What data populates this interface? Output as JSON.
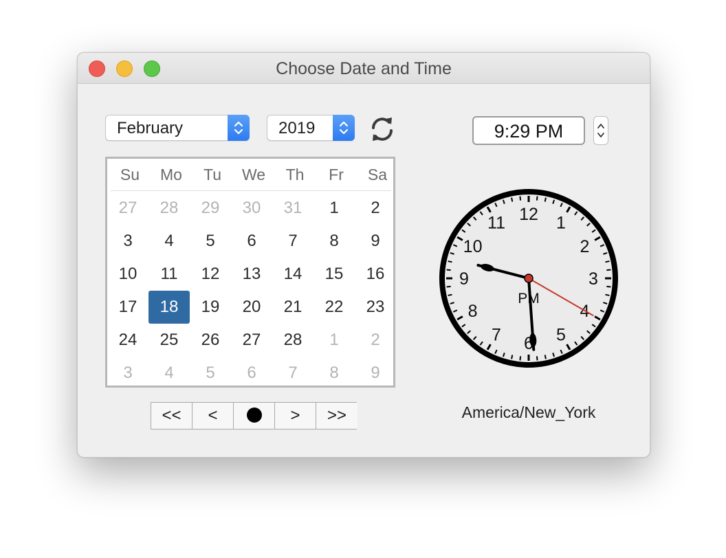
{
  "window": {
    "title": "Choose Date and Time"
  },
  "month_popup": {
    "value": "February"
  },
  "year_popup": {
    "value": "2019"
  },
  "refresh_icon": "refresh-icon",
  "time": {
    "value": "9:29 PM"
  },
  "calendar": {
    "weekdays": [
      "Su",
      "Mo",
      "Tu",
      "We",
      "Th",
      "Fr",
      "Sa"
    ],
    "weeks": [
      [
        {
          "d": "27",
          "o": true
        },
        {
          "d": "28",
          "o": true
        },
        {
          "d": "29",
          "o": true
        },
        {
          "d": "30",
          "o": true
        },
        {
          "d": "31",
          "o": true
        },
        {
          "d": "1"
        },
        {
          "d": "2"
        }
      ],
      [
        {
          "d": "3"
        },
        {
          "d": "4"
        },
        {
          "d": "5"
        },
        {
          "d": "6"
        },
        {
          "d": "7"
        },
        {
          "d": "8"
        },
        {
          "d": "9"
        }
      ],
      [
        {
          "d": "10"
        },
        {
          "d": "11"
        },
        {
          "d": "12"
        },
        {
          "d": "13"
        },
        {
          "d": "14"
        },
        {
          "d": "15"
        },
        {
          "d": "16"
        }
      ],
      [
        {
          "d": "17"
        },
        {
          "d": "18",
          "sel": true
        },
        {
          "d": "19"
        },
        {
          "d": "20"
        },
        {
          "d": "21"
        },
        {
          "d": "22"
        },
        {
          "d": "23"
        }
      ],
      [
        {
          "d": "24"
        },
        {
          "d": "25"
        },
        {
          "d": "26"
        },
        {
          "d": "27"
        },
        {
          "d": "28"
        },
        {
          "d": "1",
          "o": true
        },
        {
          "d": "2",
          "o": true
        }
      ],
      [
        {
          "d": "3",
          "o": true
        },
        {
          "d": "4",
          "o": true
        },
        {
          "d": "5",
          "o": true
        },
        {
          "d": "6",
          "o": true
        },
        {
          "d": "7",
          "o": true
        },
        {
          "d": "8",
          "o": true
        },
        {
          "d": "9",
          "o": true
        }
      ]
    ],
    "selected_color": "#2f6aa3"
  },
  "nav": {
    "first": "<<",
    "prev": "<",
    "today": "today-dot-icon",
    "next": ">",
    "last": ">>"
  },
  "clock": {
    "numbers": [
      "12",
      "1",
      "2",
      "3",
      "4",
      "5",
      "6",
      "7",
      "8",
      "9",
      "10",
      "11"
    ],
    "ampm": "PM",
    "hour": 9,
    "minute": 29,
    "second": 20,
    "second_hand_color": "#c8382e"
  },
  "timezone": "America/New_York"
}
